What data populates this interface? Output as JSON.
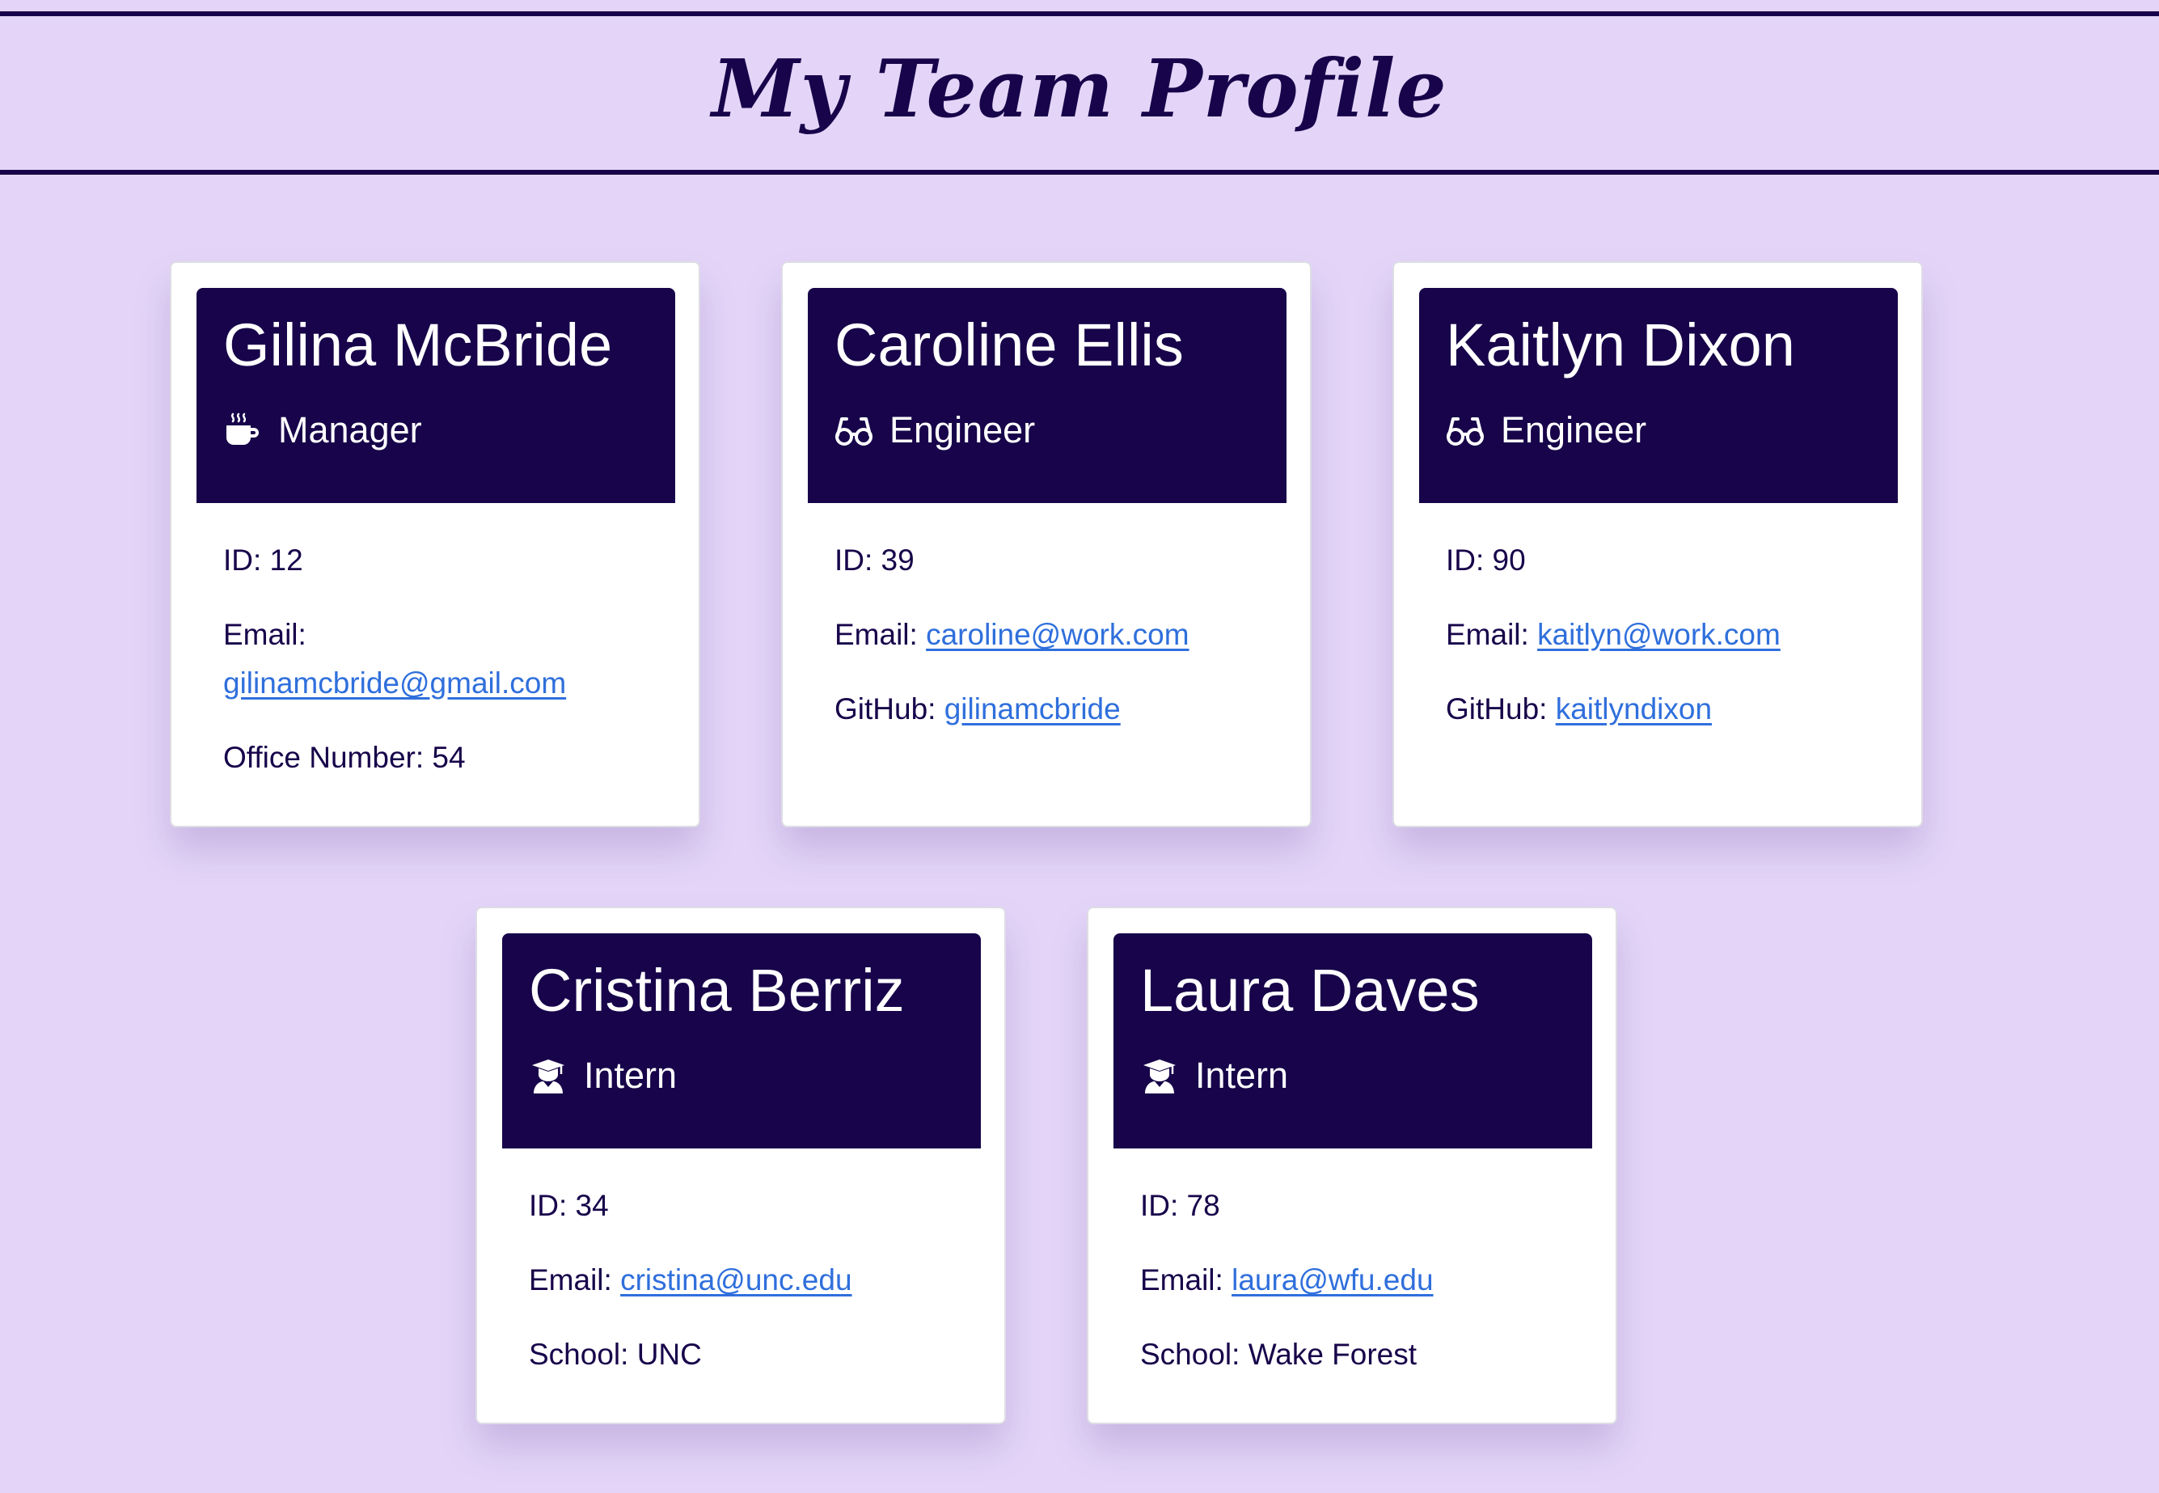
{
  "header": {
    "title": "My Team Profile"
  },
  "team": [
    {
      "name": "Gilina McBride",
      "role": "Manager",
      "role_icon": "coffee-mug-icon",
      "id_label": "ID: 12",
      "email_label": "Email:",
      "email": "gilinamcbride@gmail.com",
      "extra_label": "Office Number: 54",
      "extra_value": ""
    },
    {
      "name": "Caroline Ellis",
      "role": "Engineer",
      "role_icon": "glasses-icon",
      "id_label": "ID: 39",
      "email_label": "Email:",
      "email": "caroline@work.com",
      "extra_label": "GitHub:",
      "extra_value": "gilinamcbride"
    },
    {
      "name": "Kaitlyn Dixon",
      "role": "Engineer",
      "role_icon": "glasses-icon",
      "id_label": "ID: 90",
      "email_label": "Email:",
      "email": "kaitlyn@work.com",
      "extra_label": "GitHub:",
      "extra_value": "kaitlyndixon"
    },
    {
      "name": "Cristina Berriz",
      "role": "Intern",
      "role_icon": "graduate-icon",
      "id_label": "ID: 34",
      "email_label": "Email:",
      "email": "cristina@unc.edu",
      "extra_label": "School: UNC",
      "extra_value": ""
    },
    {
      "name": "Laura Daves",
      "role": "Intern",
      "role_icon": "graduate-icon",
      "id_label": "ID: 78",
      "email_label": "Email:",
      "email": "laura@wfu.edu",
      "extra_label": "School: Wake Forest",
      "extra_value": ""
    }
  ],
  "colors": {
    "page_background": "#e4d5f8",
    "header_dark": "#17044a",
    "card_background": "#ffffff",
    "link": "#2f6fdc"
  }
}
